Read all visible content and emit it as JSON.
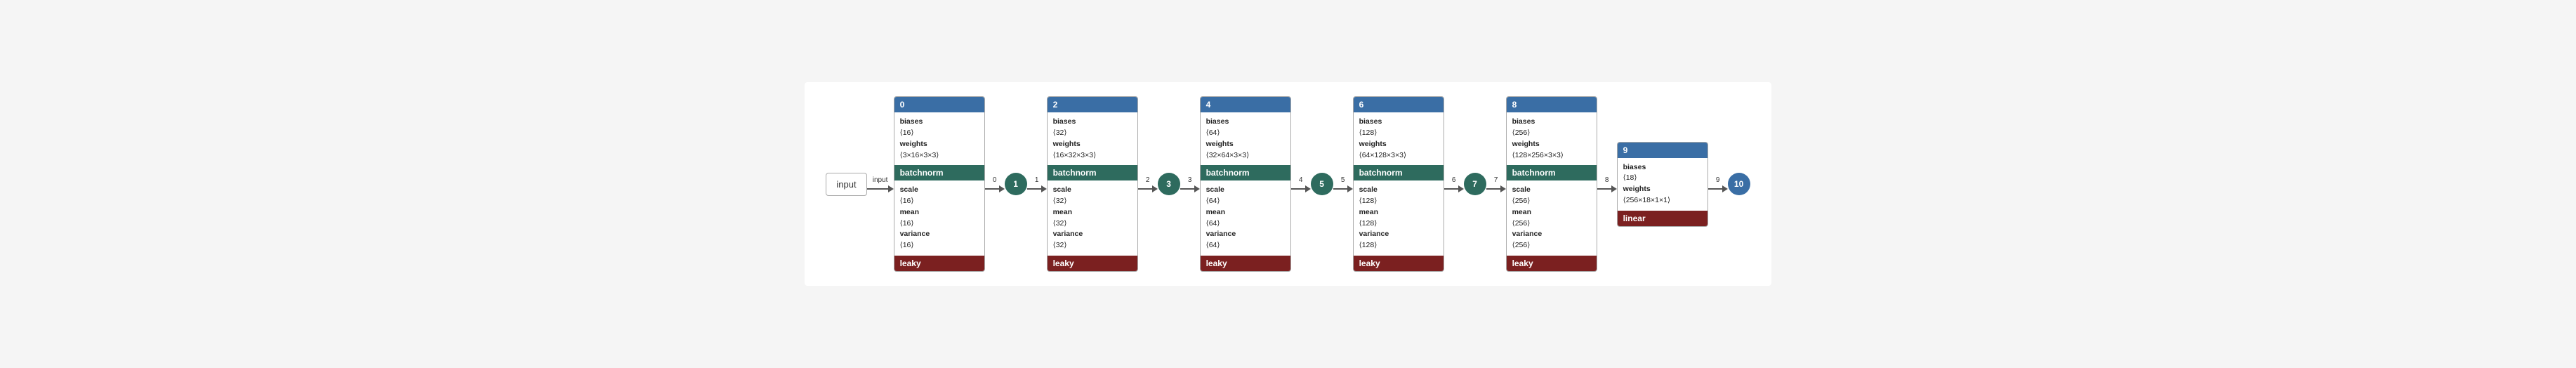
{
  "input": {
    "label": "input",
    "sublabel": "input"
  },
  "blocks": [
    {
      "id": "0",
      "params_label1": "biases",
      "params_size1": "⟨16⟩",
      "params_label2": "weights",
      "params_size2": "⟨3×16×3×3⟩",
      "batchnorm_label": "batchnorm",
      "scale_label1": "scale",
      "scale_size1": "⟨16⟩",
      "scale_label2": "mean",
      "scale_size2": "⟨16⟩",
      "scale_label3": "variance",
      "scale_size3": "⟨16⟩",
      "leaky_label": "leaky"
    },
    {
      "id": "2",
      "params_label1": "biases",
      "params_size1": "⟨32⟩",
      "params_label2": "weights",
      "params_size2": "⟨16×32×3×3⟩",
      "batchnorm_label": "batchnorm",
      "scale_label1": "scale",
      "scale_size1": "⟨32⟩",
      "scale_label2": "mean",
      "scale_size2": "⟨32⟩",
      "scale_label3": "variance",
      "scale_size3": "⟨32⟩",
      "leaky_label": "leaky"
    },
    {
      "id": "4",
      "params_label1": "biases",
      "params_size1": "⟨64⟩",
      "params_label2": "weights",
      "params_size2": "⟨32×64×3×3⟩",
      "batchnorm_label": "batchnorm",
      "scale_label1": "scale",
      "scale_size1": "⟨64⟩",
      "scale_label2": "mean",
      "scale_size2": "⟨64⟩",
      "scale_label3": "variance",
      "scale_size3": "⟨64⟩",
      "leaky_label": "leaky"
    },
    {
      "id": "6",
      "params_label1": "biases",
      "params_size1": "⟨128⟩",
      "params_label2": "weights",
      "params_size2": "⟨64×128×3×3⟩",
      "batchnorm_label": "batchnorm",
      "scale_label1": "scale",
      "scale_size1": "⟨128⟩",
      "scale_label2": "mean",
      "scale_size2": "⟨128⟩",
      "scale_label3": "variance",
      "scale_size3": "⟨128⟩",
      "leaky_label": "leaky"
    },
    {
      "id": "8",
      "params_label1": "biases",
      "params_size1": "⟨256⟩",
      "params_label2": "weights",
      "params_size2": "⟨128×256×3×3⟩",
      "batchnorm_label": "batchnorm",
      "scale_label1": "scale",
      "scale_size1": "⟨256⟩",
      "scale_label2": "mean",
      "scale_size2": "⟨256⟩",
      "scale_label3": "variance",
      "scale_size3": "⟨256⟩",
      "leaky_label": "leaky"
    }
  ],
  "circle_nodes": [
    "1",
    "3",
    "5",
    "7"
  ],
  "node9": {
    "id": "9",
    "params_label1": "biases",
    "params_size1": "⟨18⟩",
    "params_label2": "weights",
    "params_size2": "⟨256×18×1×1⟩",
    "linear_label": "linear"
  },
  "node10": {
    "id": "10"
  },
  "edge_labels": [
    "0",
    "1",
    "2",
    "3",
    "4",
    "5",
    "6",
    "7",
    "8",
    "9"
  ]
}
